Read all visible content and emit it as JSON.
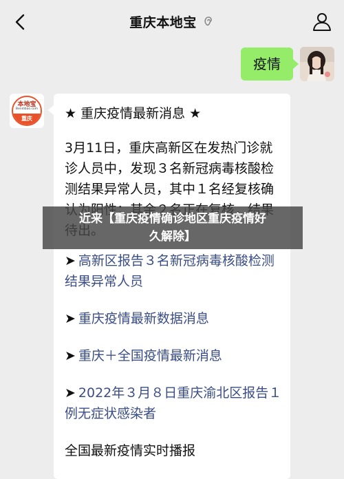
{
  "header": {
    "title": "重庆本地宝",
    "back_icon": "chevron-left-icon",
    "title_icon": "ear-icon",
    "profile_icon": "person-icon"
  },
  "chat": {
    "user_message": "疫情",
    "official_avatar": {
      "top_text": "本地宝",
      "mid_text": "Bendibao.com",
      "bottom_text": "重庆"
    },
    "card": {
      "heading": "★ 重庆疫情最新消息 ★",
      "paragraph": "3月11日，重庆高新区在发热门诊就诊人员中，发现３名新冠病毒核酸检测结果异常人员，其中１名经复核确认为阳性；其余２名正在复核，结果待出。",
      "links": [
        {
          "arrow": "➤",
          "text": "高新区报告３名新冠病毒核酸检测结果异常人员"
        },
        {
          "arrow": "➤",
          "text": "重庆疫情最新数据消息"
        },
        {
          "arrow": "➤",
          "text": "重庆＋全国疫情最新消息"
        },
        {
          "arrow": "➤",
          "text": "2022年３月８日重庆渝北区报告１例无症状感染者"
        }
      ],
      "last_line": "全国最新疫情实时播报"
    }
  },
  "overlay": {
    "line1": "近来【重庆疫情确诊地区重庆疫情好",
    "line2": "久解除】"
  },
  "colors": {
    "background": "#ededed",
    "bubble_green": "#95ec69",
    "link_blue": "#3a4d86",
    "logo_orange": "#e8522a"
  }
}
